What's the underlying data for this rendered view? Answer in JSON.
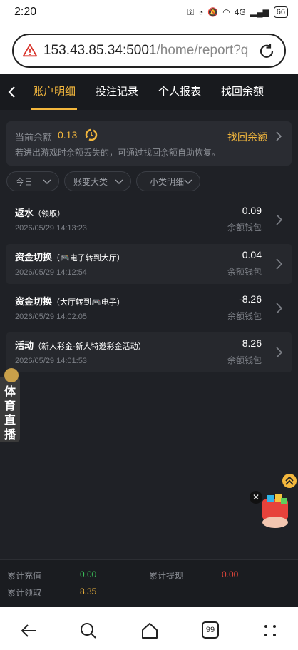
{
  "status_bar": {
    "time": "2:20",
    "network": "4G",
    "battery": "66"
  },
  "browser": {
    "url_host": "153.43.85.34:5001",
    "url_path": "/home/report?q",
    "tab_count": "99",
    "icons": [
      "warning-icon",
      "reload-icon",
      "back-arrow-icon",
      "search-icon",
      "home-icon",
      "tabs-icon",
      "more-icon"
    ]
  },
  "nav": {
    "tabs": [
      {
        "label": "账户明细",
        "active": true
      },
      {
        "label": "投注记录",
        "active": false
      },
      {
        "label": "个人报表",
        "active": false
      },
      {
        "label": "找回余额",
        "active": false
      }
    ]
  },
  "balance": {
    "label": "当前余额",
    "value": "0.13",
    "recover_label": "找回余额",
    "hint": "若进出游戏时余额丢失的，可通过找回余额自助恢复。"
  },
  "filters": [
    {
      "label": "今日"
    },
    {
      "label": "账变大类"
    },
    {
      "label": "小类明细"
    }
  ],
  "records": [
    {
      "title": "返水",
      "sub": "（领取）",
      "time": "2026/05/29 14:13:23",
      "amount": "0.09",
      "wallet": "余额钱包"
    },
    {
      "title": "资金切换",
      "sub": "（🎮电子转到大厅）",
      "time": "2026/05/29 14:12:54",
      "amount": "0.04",
      "wallet": "余额钱包"
    },
    {
      "title": "资金切换",
      "sub": "（大厅转到🎮电子）",
      "time": "2026/05/29 14:02:05",
      "amount": "-8.26",
      "wallet": "余额钱包"
    },
    {
      "title": "活动",
      "sub": "（新人彩金-新人特邀彩金活动）",
      "time": "2026/05/29 14:01:53",
      "amount": "8.26",
      "wallet": "余额钱包"
    }
  ],
  "floating": {
    "sports_label": "体育直播"
  },
  "summary": {
    "recharge_label": "累计充值",
    "recharge_value": "0.00",
    "withdraw_label": "累计提现",
    "withdraw_value": "0.00",
    "claimed_label": "累计领取",
    "claimed_value": "8.35"
  },
  "colors": {
    "accent": "#f3b73d",
    "background": "#1f2126",
    "positive": "#3cc45a",
    "negative": "#e0453b",
    "claimed": "#f3b73d"
  }
}
